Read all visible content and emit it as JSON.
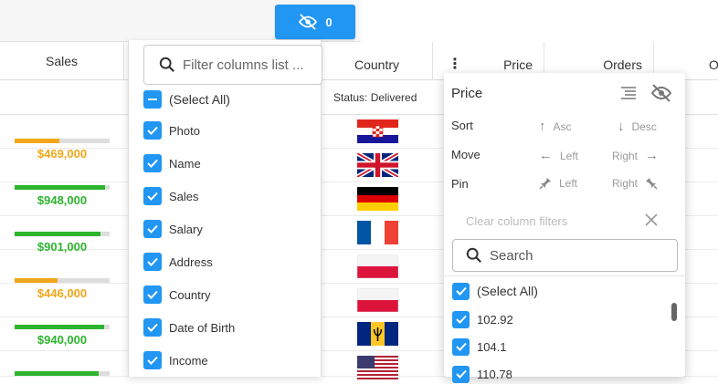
{
  "toolbar": {
    "hidden_count": "0"
  },
  "header": {
    "sales": "Sales",
    "country": "Country",
    "price": "Price",
    "orders": "Orders",
    "next_partial": "O"
  },
  "filter_row": {
    "status_text": "Status: Delivered"
  },
  "sales_rows": [
    {
      "value": "$469,000",
      "pct": 0.47,
      "color": "#f2a619"
    },
    {
      "value": "$948,000",
      "pct": 0.95,
      "color": "#2db52d"
    },
    {
      "value": "$901,000",
      "pct": 0.9,
      "color": "#2db52d"
    },
    {
      "value": "$446,000",
      "pct": 0.45,
      "color": "#f2a619"
    },
    {
      "value": "$940,000",
      "pct": 0.94,
      "color": "#2db52d"
    },
    {
      "value": "",
      "pct": 0.88,
      "color": "#2db52d"
    }
  ],
  "flags": [
    "croatia",
    "united-kingdom",
    "germany",
    "france",
    "poland",
    "poland",
    "barbados",
    "usa"
  ],
  "chooser": {
    "search_placeholder": "Filter columns list ...",
    "select_all": "(Select All)",
    "items": [
      "Photo",
      "Name",
      "Sales",
      "Salary",
      "Address",
      "Country",
      "Date of Birth",
      "Income"
    ]
  },
  "column_menu": {
    "title": "Price",
    "sort_label": "Sort",
    "sort_asc": "Asc",
    "sort_desc": "Desc",
    "move_label": "Move",
    "move_left": "Left",
    "move_right": "Right",
    "pin_label": "Pin",
    "pin_left": "Left",
    "pin_right": "Right",
    "clear_filters": "Clear column filters",
    "search_placeholder": "Search",
    "select_all": "(Select All)",
    "values": [
      "102.92",
      "104.1",
      "110.78"
    ]
  },
  "colors": {
    "accent": "#2196f3",
    "orange": "#f2a619",
    "green": "#2db52d"
  }
}
